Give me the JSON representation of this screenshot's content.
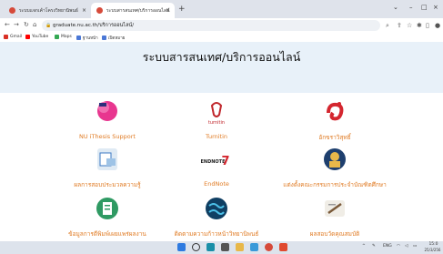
{
  "browser": {
    "tabs": [
      {
        "title": "ระบบแจกเค้าโครงวิทยานิพนธ์",
        "active": false
      },
      {
        "title": "ระบบสารสนเทศ/บริการออนไลน์",
        "active": true
      }
    ],
    "url": "graduate.nu.ac.th/บริการออนไลน์/",
    "bookmarks": [
      "Gmail",
      "YouTube",
      "Maps",
      "ฐานหน้า",
      "เปิดหมาย"
    ]
  },
  "page": {
    "title": "ระบบสารสนเทศ/บริการออนไลน์",
    "services": [
      {
        "label": "NU iThesis Support",
        "icon": "ithesis-logo-icon"
      },
      {
        "label": "Turnitin",
        "icon": "turnitin-logo-icon"
      },
      {
        "label": "อักขราวิสุทธิ์",
        "icon": "akarawisut-logo-icon"
      },
      {
        "label": "ผลการสอบประมวลความรู้",
        "icon": "exam-result-icon"
      },
      {
        "label": "EndNote",
        "icon": "endnote-logo-icon"
      },
      {
        "label": "แต่งตั้งคณะกรรมการประจำบัณฑิตศึกษา",
        "icon": "committee-icon"
      },
      {
        "label": "ข้อมูลการตีพิมพ์เผยแพร่ผลงาน",
        "icon": "publication-icon"
      },
      {
        "label": "ติดตามความก้าวหน้าวิทยานิพนธ์",
        "icon": "progress-globe-icon"
      },
      {
        "label": "ผลสอบวัดคุณสมบัติ",
        "icon": "qualifying-exam-icon"
      }
    ]
  },
  "taskbar": {
    "tray_lang": "ENG",
    "time": "15:0",
    "date": "25/3/256"
  },
  "colors": {
    "accent": "#e07b24",
    "hero_bg": "#e8f1f9"
  }
}
